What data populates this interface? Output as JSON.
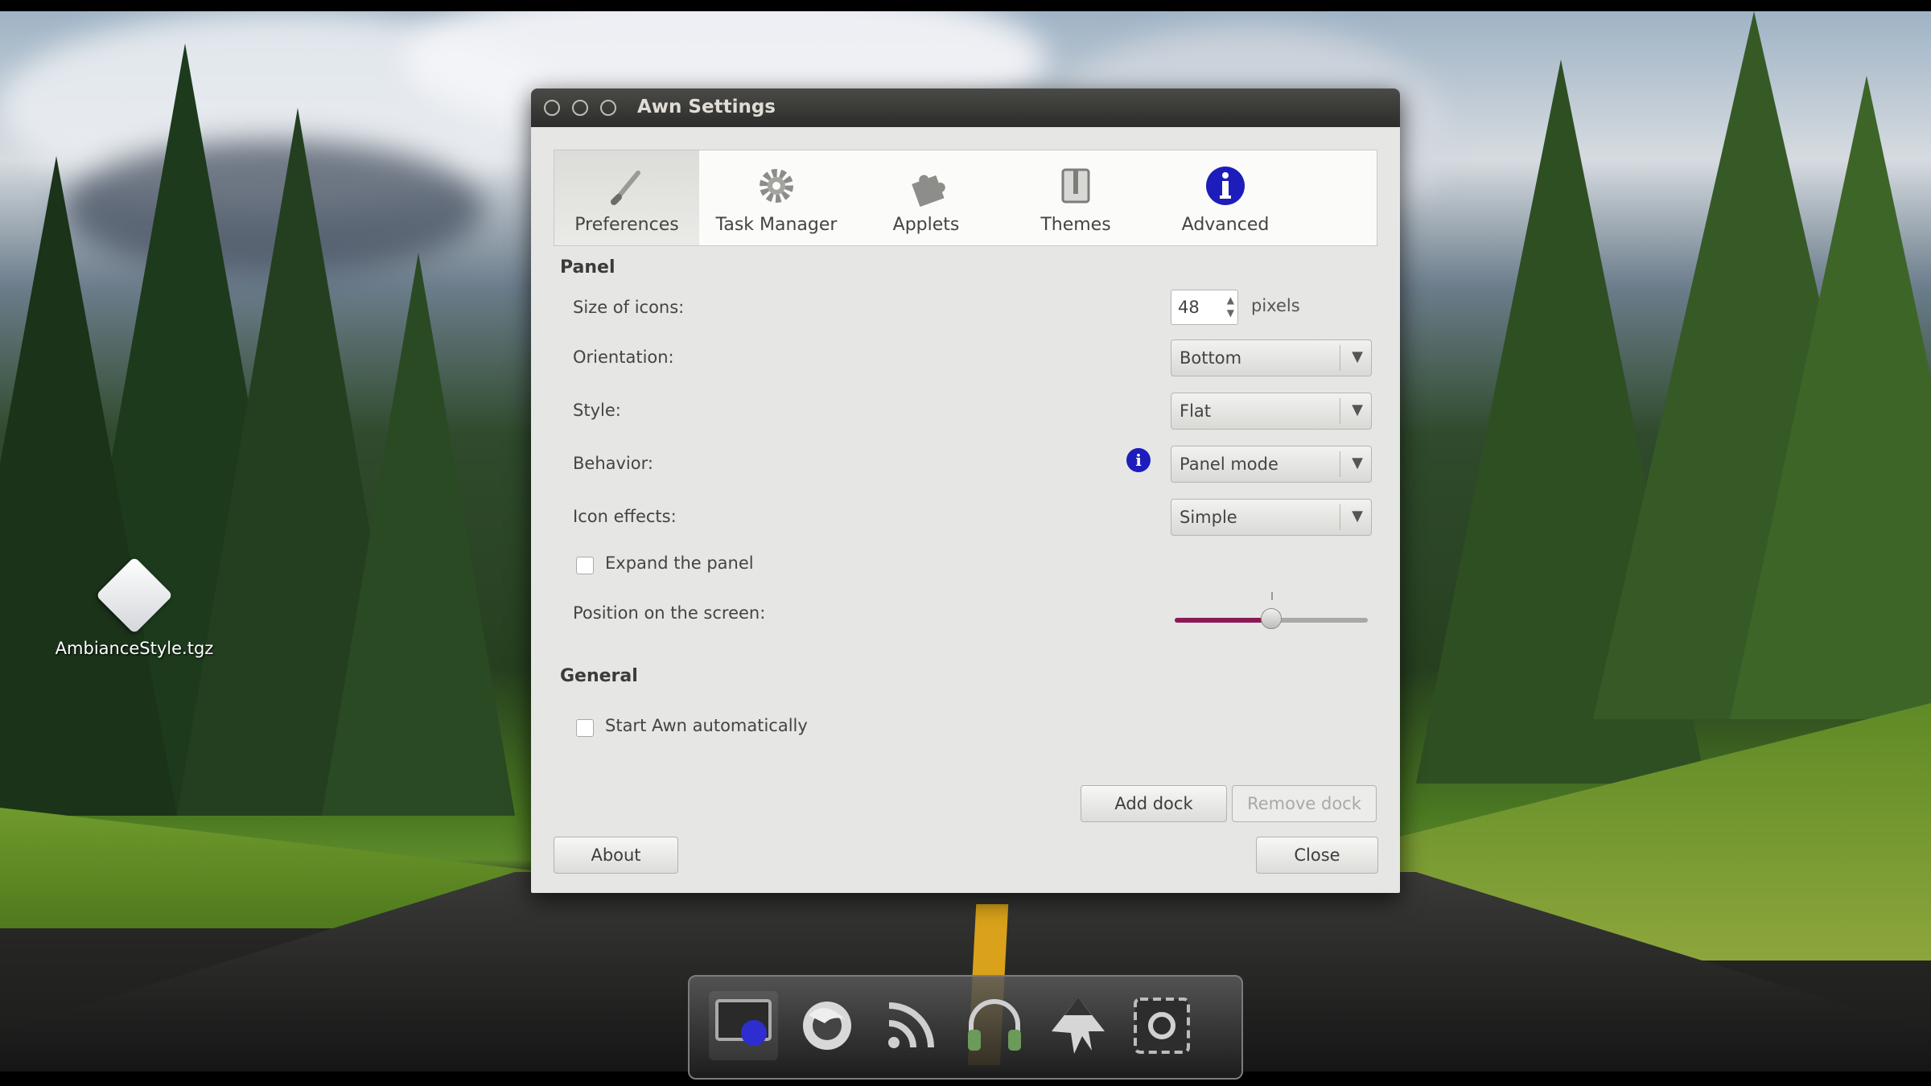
{
  "window": {
    "title": "Awn Settings",
    "tabs": [
      {
        "label": "Preferences",
        "icon": "paintbrush-icon",
        "active": true
      },
      {
        "label": "Task Manager",
        "icon": "gear-icon",
        "active": false
      },
      {
        "label": "Applets",
        "icon": "puzzle-icon",
        "active": false
      },
      {
        "label": "Themes",
        "icon": "theme-book-icon",
        "active": false
      },
      {
        "label": "Advanced",
        "icon": "info-icon",
        "active": false
      }
    ],
    "panel": {
      "heading": "Panel",
      "size_label": "Size of icons:",
      "size_value": "48",
      "size_units": "pixels",
      "orientation_label": "Orientation:",
      "orientation_value": "Bottom",
      "style_label": "Style:",
      "style_value": "Flat",
      "behavior_label": "Behavior:",
      "behavior_value": "Panel mode",
      "effects_label": "Icon effects:",
      "effects_value": "Simple",
      "expand_label": "Expand the panel",
      "expand_checked": false,
      "position_label": "Position on the screen:",
      "position_value": 0.5
    },
    "general": {
      "heading": "General",
      "autostart_label": "Start Awn automatically",
      "autostart_checked": false
    },
    "buttons": {
      "add_dock": "Add dock",
      "remove_dock": "Remove dock",
      "about": "About",
      "close": "Close"
    }
  },
  "desktop": {
    "file_label": "AmbianceStyle.tgz"
  },
  "dock": {
    "items": [
      {
        "icon": "awn-settings-icon",
        "active": true
      },
      {
        "icon": "firefox-icon",
        "active": false
      },
      {
        "icon": "rss-feed-icon",
        "active": false
      },
      {
        "icon": "headphones-icon",
        "active": false
      },
      {
        "icon": "inkscape-icon",
        "active": false
      },
      {
        "icon": "screenshot-icon",
        "active": false
      }
    ]
  },
  "colors": {
    "accent": "#8a1a55",
    "info_blue": "#1d1dbb",
    "titlebar": "#3a3a37"
  }
}
